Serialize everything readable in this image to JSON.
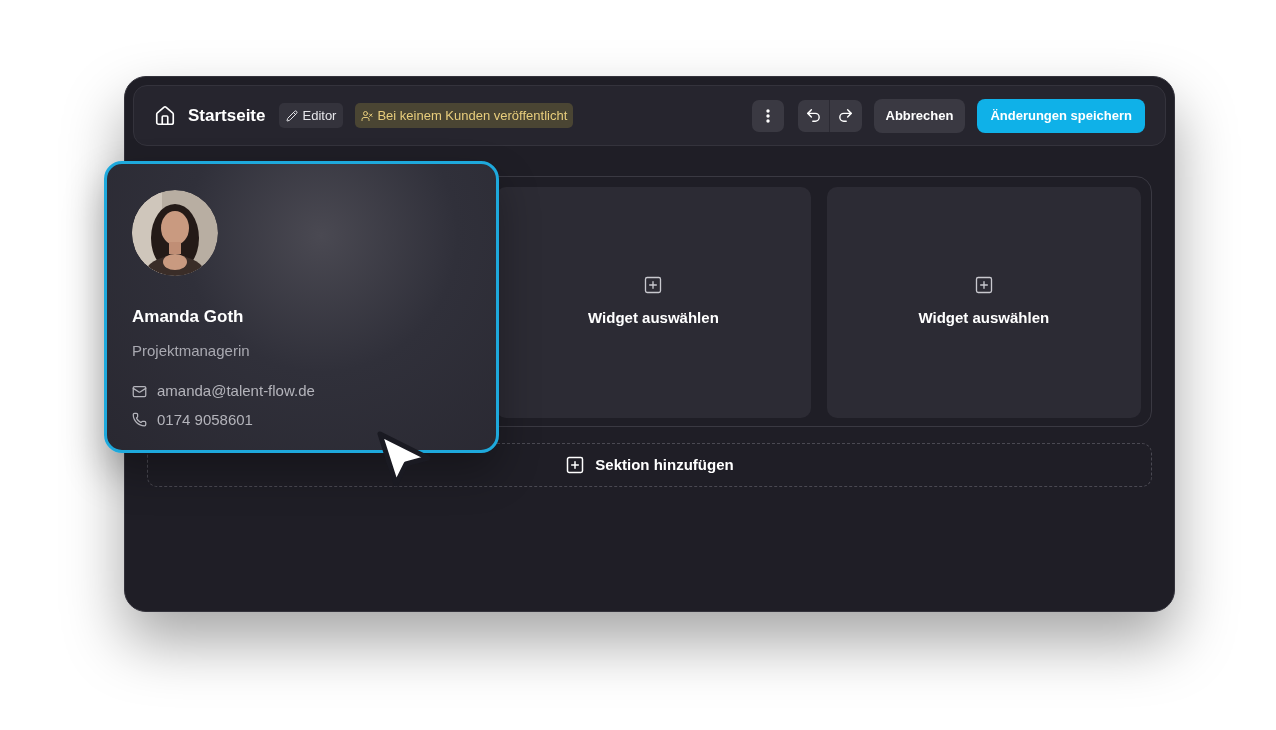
{
  "header": {
    "title": "Startseite",
    "mode_badge": "Editor",
    "status_badge": "Bei keinem Kunden veröffentlicht",
    "cancel_button": "Abbrechen",
    "save_button": "Änderungen speichern"
  },
  "section": {
    "widgets": [
      {
        "label": "Widget auswählen"
      },
      {
        "label": "Widget auswählen"
      }
    ]
  },
  "add_section": "Sektion hinzufügen",
  "profile_card": {
    "name": "Amanda Goth",
    "role": "Projektmanagerin",
    "email": "amanda@talent-flow.de",
    "phone": "0174 9058601"
  }
}
